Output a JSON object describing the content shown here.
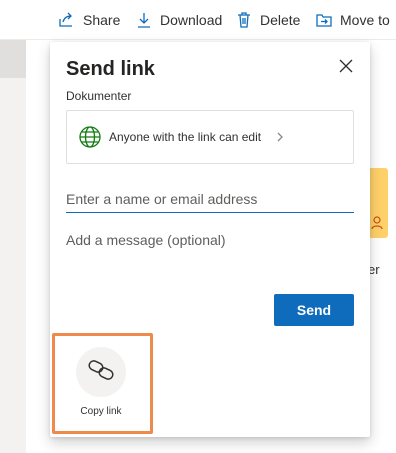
{
  "command_bar": {
    "items": [
      {
        "label": "Share",
        "icon": "share-icon"
      },
      {
        "label": "Download",
        "icon": "download-icon"
      },
      {
        "label": "Delete",
        "icon": "trash-icon"
      },
      {
        "label": "Move to",
        "icon": "move-icon"
      }
    ]
  },
  "background": {
    "peek_text": "er"
  },
  "dialog": {
    "title": "Send link",
    "subtitle": "Dokumenter",
    "permission": {
      "label": "Anyone with the link can edit",
      "icon": "globe-icon"
    },
    "recipient": {
      "placeholder": "Enter a name or email address",
      "value": ""
    },
    "message": {
      "placeholder": "Add a message (optional)",
      "value": ""
    },
    "send_label": "Send",
    "copy_link": {
      "label": "Copy link",
      "icon": "link-icon"
    }
  },
  "colors": {
    "accent": "#0f6cbd",
    "highlight": "#ee8a4b",
    "globe": "#107c10",
    "folder": "#ffd16a"
  }
}
